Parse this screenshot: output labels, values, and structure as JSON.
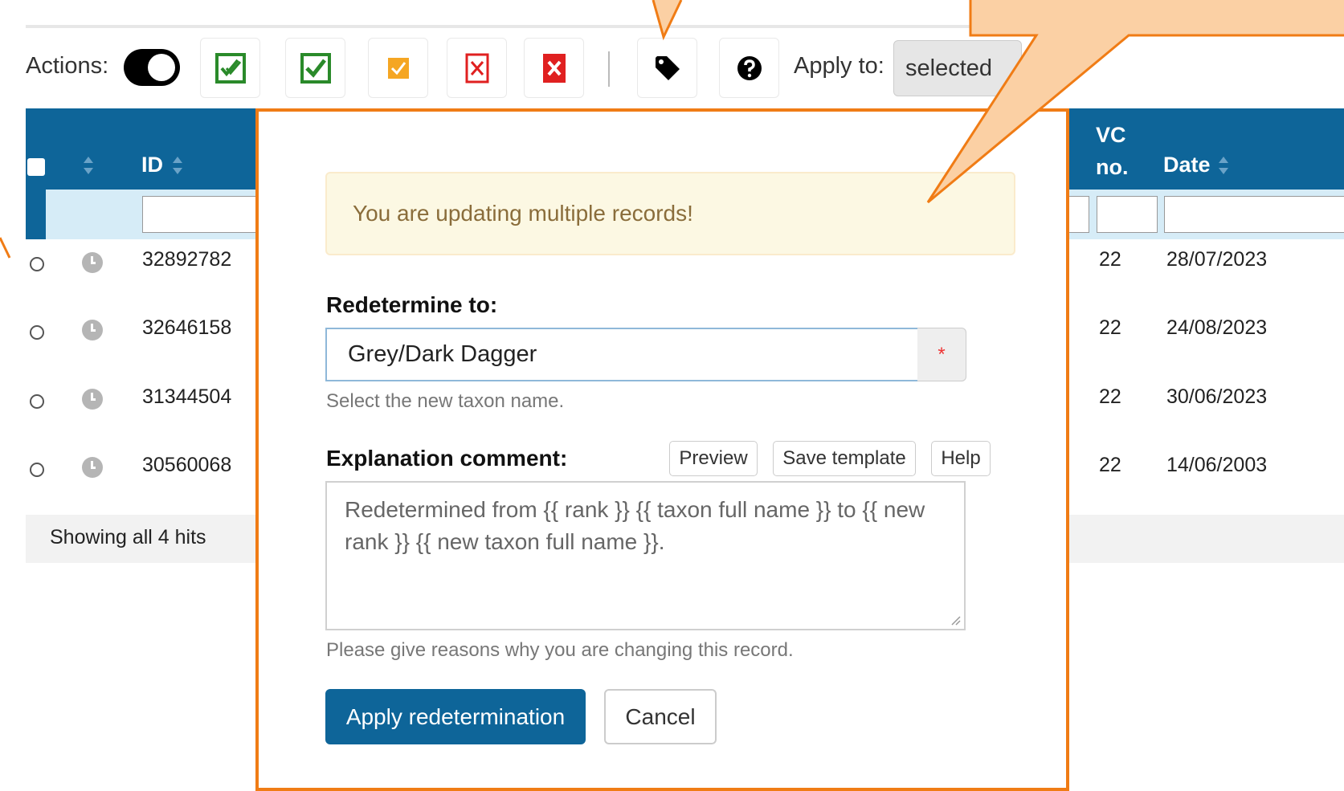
{
  "toolbar": {
    "actions_label": "Actions:",
    "apply_to_label": "Apply to:",
    "apply_to_value": "selected",
    "buttons": [
      {
        "icon": "double-check-icon",
        "color": "#2a8a2a"
      },
      {
        "icon": "check-icon",
        "color": "#2a8a2a"
      },
      {
        "icon": "query-check-icon",
        "color": "#f5a623"
      },
      {
        "icon": "cross-outline-icon",
        "color": "#e02020"
      },
      {
        "icon": "cross-filled-icon",
        "color": "#e02020"
      },
      {
        "icon": "tag-icon",
        "color": "#000000"
      },
      {
        "icon": "help-icon",
        "color": "#000000"
      }
    ]
  },
  "table": {
    "headers": {
      "id": "ID",
      "vc_line1": "VC",
      "vc_line2": "no.",
      "date": "Date"
    },
    "rows": [
      {
        "id": "32892782",
        "vc": "22",
        "date": "28/07/2023"
      },
      {
        "id": "32646158",
        "vc": "22",
        "date": "24/08/2023"
      },
      {
        "id": "31344504",
        "vc": "22",
        "date": "30/06/2023"
      },
      {
        "id": "30560068",
        "vc": "22",
        "date": "14/06/2003"
      }
    ],
    "footer": "Showing all 4 hits"
  },
  "modal": {
    "alert": "You are updating multiple records!",
    "redetermine_label": "Redetermine to:",
    "taxon_value": "Grey/Dark Dagger",
    "required_marker": "*",
    "taxon_help": "Select the new taxon name.",
    "comment_label": "Explanation comment:",
    "preview_label": "Preview",
    "save_template_label": "Save template",
    "help_label": "Help",
    "comment_value": "Redetermined from {{ rank }} {{ taxon full name }} to {{ new rank }} {{ new taxon full name }}.",
    "comment_help": "Please give reasons why you are changing this record.",
    "apply_label": "Apply redetermination",
    "cancel_label": "Cancel"
  },
  "colors": {
    "table_header": "#0e6599",
    "modal_border": "#f07c15",
    "callout_fill": "#fbd0a4"
  }
}
